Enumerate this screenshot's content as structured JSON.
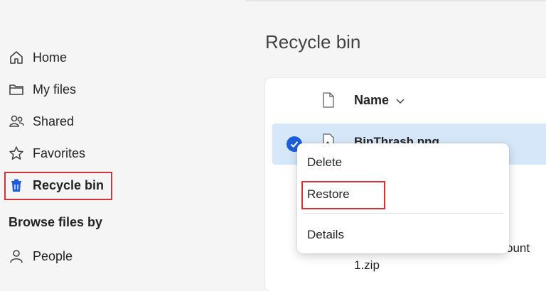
{
  "sidebar": {
    "items": [
      {
        "label": "Home",
        "icon": "home-icon"
      },
      {
        "label": "My files",
        "icon": "folder-icon"
      },
      {
        "label": "Shared",
        "icon": "people-icon"
      },
      {
        "label": "Favorites",
        "icon": "star-icon"
      },
      {
        "label": "Recycle bin",
        "icon": "trash-icon"
      }
    ],
    "browse_title": "Browse files by",
    "browse_items": [
      {
        "label": "People",
        "icon": "person-icon"
      }
    ]
  },
  "main": {
    "title": "Recycle bin",
    "columns": {
      "name": "Name"
    },
    "rows": [
      {
        "name": "BinThrash.png",
        "selected": true
      },
      {
        "name_part1": "ount",
        "name_part2": "1.zip"
      }
    ]
  },
  "context_menu": {
    "items": [
      "Delete",
      "Restore",
      "Details"
    ]
  },
  "colors": {
    "accent": "#1d5ed8",
    "selected_row": "#d6e7fa",
    "highlight_box": "#d13438"
  }
}
